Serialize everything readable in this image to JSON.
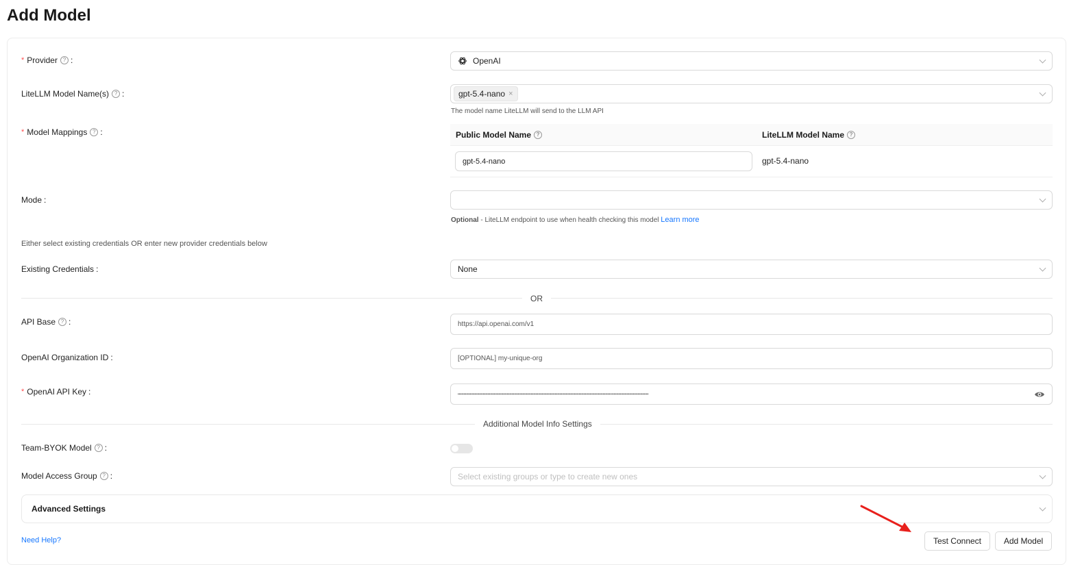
{
  "page": {
    "title": "Add Model"
  },
  "provider": {
    "label": "Provider",
    "value": "OpenAI",
    "icon": "openai-logo-icon"
  },
  "model_names": {
    "label": "LiteLLM Model Name(s)",
    "tag": "gpt-5.4-nano",
    "hint": "The model name LiteLLM will send to the LLM API"
  },
  "mappings": {
    "label": "Model Mappings",
    "col_public": "Public Model Name",
    "col_litellm": "LiteLLM Model Name",
    "rows": [
      {
        "public": "gpt-5.4-nano",
        "litellm": "gpt-5.4-nano"
      }
    ]
  },
  "mode": {
    "label": "Mode",
    "hint_bold": "Optional",
    "hint_text": "- LiteLLM endpoint to use when health checking this model",
    "learn_more": "Learn more"
  },
  "credentials": {
    "note": "Either select existing credentials OR enter new provider credentials below",
    "label": "Existing Credentials",
    "value": "None",
    "divider": "OR"
  },
  "api_base": {
    "label": "API Base",
    "value": "https://api.openai.com/v1"
  },
  "org_id": {
    "label": "OpenAI Organization ID",
    "placeholder": "[OPTIONAL] my-unique-org"
  },
  "api_key": {
    "label": "OpenAI API Key",
    "masked": "•••••••••••••••••••••••••••••••••••••••••••••••••••••••••••••••••••••••••••••••••••••••••••••••••••••••••••••••••••••••••••••••••••••••••••••••••••••••••••••••"
  },
  "additional": {
    "divider": "Additional Model Info Settings"
  },
  "byok": {
    "label": "Team-BYOK Model",
    "enabled": false
  },
  "access_group": {
    "label": "Model Access Group",
    "placeholder": "Select existing groups or type to create new ones"
  },
  "advanced": {
    "title": "Advanced Settings"
  },
  "footer": {
    "help": "Need Help?",
    "test_connect": "Test Connect",
    "add_model": "Add Model"
  },
  "colors": {
    "accent": "#1677ff",
    "required": "#ff4d4f",
    "annotation_arrow": "#e8201c"
  }
}
